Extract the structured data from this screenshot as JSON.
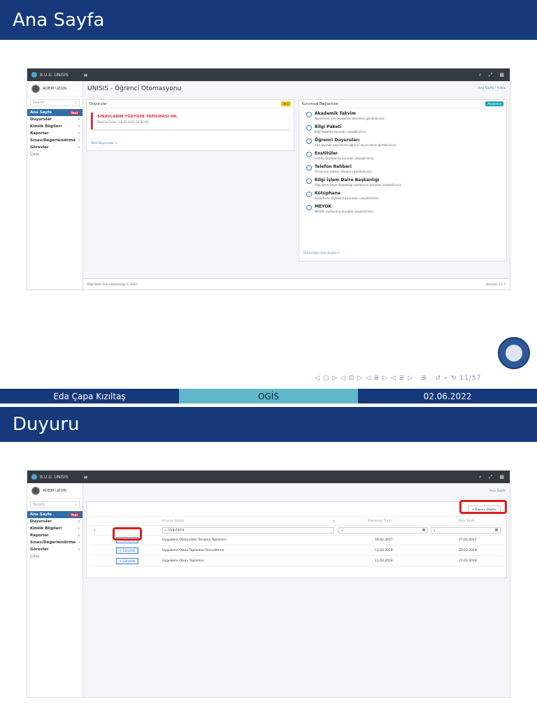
{
  "slide1": {
    "title": "Ana Sayfa",
    "app": {
      "brand": "B.U.U. UNISIS",
      "user": "ADEM UZUN",
      "search_placeholder": "Search",
      "nav": [
        "Ana Sayfa",
        "Duyurular",
        "Kimlik Bilgileri",
        "Raporlar",
        "Sınav/Değerlendirme",
        "Görevler",
        "Çıkış"
      ],
      "new_badge": "Yeni",
      "page_title": "UNISIS - Öğrenci Otomasyonu",
      "breadcrumb": "Ana Sayfa / Index",
      "duyurular_header": "Duyurular",
      "duyurular_badge": "Yeni",
      "announcement_title": "SINAVLARIN YÜZYÜZE YAPILMASI HK.",
      "announcement_date": "Oluşma Tarihi : 20.02.2022 00:00:00",
      "all_announcements": "Tüm Duyurular >",
      "links_header": "Kurumsal Bağlantılar",
      "links_badge": "Akademik",
      "links": [
        {
          "title": "Akademik Takvim",
          "desc": "Yayınlanan tüm akademik takvimleri görebilirsiniz."
        },
        {
          "title": "Bilgi Paketi",
          "desc": "Bilgi Paketine buradan ulaşabilirsiniz."
        },
        {
          "title": "Öğrenci Duyuruları",
          "desc": "Ana sayfada yayınlanan öğrenci duyurularını görebilirsiniz."
        },
        {
          "title": "Enstitüler",
          "desc": "Enstitü Sayfalarına buradan ulaşabilirsiniz."
        },
        {
          "title": "Telefon Rehberi",
          "desc": "Üniversite telefon rehberini görebilirsiniz."
        },
        {
          "title": "Bilgi İşlem Daire Başkanlığı",
          "desc": "Bilgi İşlem Daire Başkanlığı sayfalarına buradan ulaşabilirsiniz."
        },
        {
          "title": "Kütüphane",
          "desc": "Kütüphane sayfalarına buradan ulaşabilirsiniz."
        },
        {
          "title": "MEYOK",
          "desc": "MEYOK sayfalarına buradan ulaşabilirsiniz."
        }
      ],
      "univ_link": "Üniversite Ana Sayfa >",
      "footer_left": "Bilgi İşlem Daire Başkanlığı © 2022",
      "footer_right": "Versiyon 3.1.7"
    },
    "page_num": "11/57",
    "footer": {
      "author": "Eda Çapa Kızıltaş",
      "short_title": "OGİS",
      "date": "02.06.2022"
    }
  },
  "slide2": {
    "title": "Duyuru",
    "app": {
      "breadcrumb": "Ana Sayfa",
      "new_button": "+ Duyuru Oluştur",
      "columns": [
        "Duyuru Başlık",
        "Başlangıç Tarihi",
        "Bitiş Tarihi"
      ],
      "filter_value": "Uygulama",
      "edit_label": "Güncelle",
      "rows": [
        {
          "title": "Uygulama Okulundaki Tanışma Toplantısı",
          "start": "19.02.2017",
          "end": "27.02.2017"
        },
        {
          "title": "Uygulama Okulu Toplantısı-Güncelleme",
          "start": "13.03.2018",
          "end": "20.03.2018"
        },
        {
          "title": "Uygulama Okulu Toplantısı",
          "start": "11.03.2018",
          "end": "21.03.2018"
        }
      ]
    }
  },
  "colors": {
    "header_blue": "#15397a",
    "footer_teal": "#5fb7c9",
    "topbar": "#343a40",
    "accent": "#2f6ea8",
    "red": "#dc3545"
  }
}
